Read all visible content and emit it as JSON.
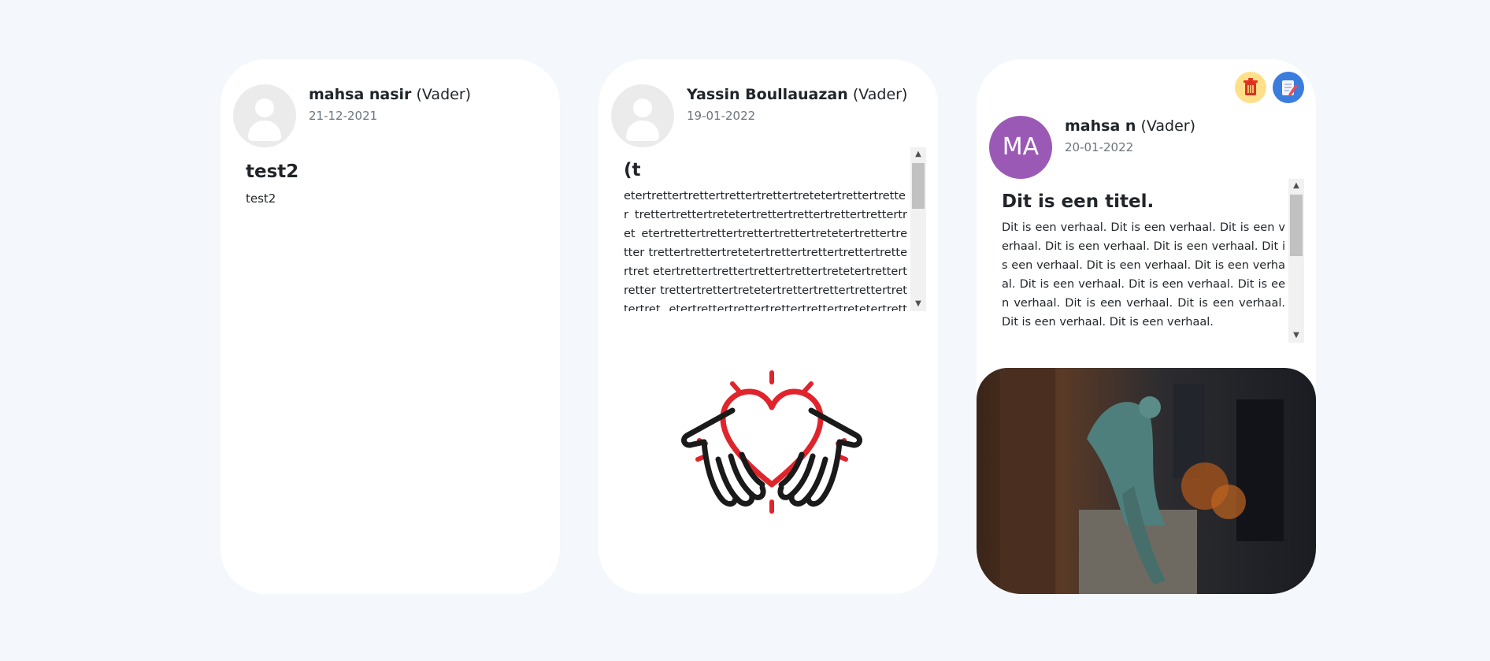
{
  "posts": [
    {
      "author_name": "mahsa nasir",
      "author_role": "(Vader)",
      "date": "21-12-2021",
      "title": "test2",
      "body": "test2"
    },
    {
      "author_name": "Yassin Boullauazan",
      "author_role": "(Vader)",
      "date": "19-01-2022",
      "title": "(t",
      "body": "etertrettertrettertrettertrettertretetertrettertretter trettertrettertretetertrettertrettertrettertrettertret etertrettertrettertrettertrettertretetertrettertretter trettertrettertretetertrettertrettertrettertrettertret etertrettertrettertrettertrettertretetertrettertretter trettertrettertretetertrettertrettertrettertrettertret etertrettertrettertrettertrettertretetertrettertretter"
    },
    {
      "author_initials": "MA",
      "author_name": "mahsa n",
      "author_role": "(Vader)",
      "date": "20-01-2022",
      "title": "Dit is een titel.",
      "body": "Dit is een verhaal. Dit is een verhaal. Dit is een verhaal. Dit is een verhaal. Dit is een verhaal. Dit is een verhaal. Dit is een verhaal. Dit is een verhaal. Dit is een verhaal. Dit is een verhaal. Dit is een verhaal. Dit is een verhaal. Dit is een verhaal. Dit is een verhaal. Dit is een verhaal.",
      "delete_icon": "trash-icon",
      "edit_icon": "edit-icon"
    }
  ],
  "colors": {
    "background": "#f4f7fb",
    "card": "#ffffff",
    "avatar_purple": "#9b59b6",
    "delete_button": "#ffe08a",
    "edit_button": "#3b7ddd",
    "heart_red": "#e0242c"
  }
}
